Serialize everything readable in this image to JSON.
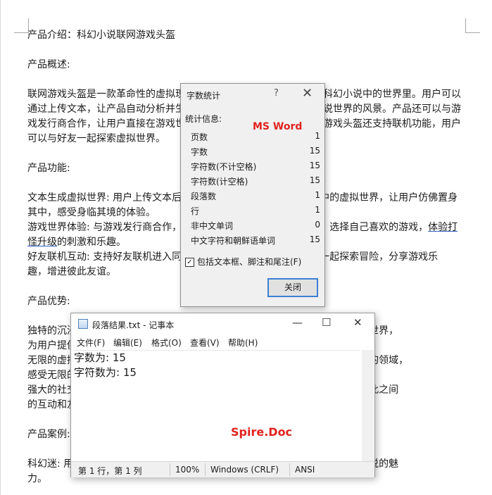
{
  "document": {
    "lines": [
      "产品介绍：科幻小说联网游戏头盔",
      "",
      "产品概述:",
      "",
      "联网游戏头盔是一款革命性的虚拟现实游戏设备，可以让用户沉浸在科幻小说中的世界里。用户可以",
      "通过上传文本，让产品自动分析并生成虚拟世界，让用户亲眼看到小说世界的风景。产品还可以与游",
      "戏发行商合作，让用户直接在游戏世界中体验小说的故事情节。联网游戏头盔还支持联机功能，用户",
      "可以与好友一起探索虚拟世界。",
      "",
      "产品功能:",
      "",
      "文本生成虚拟世界: 用户上传文本后，产品自动分析并生成对应小说中的虚拟世界，让用户仿佛置身",
      "其中，感受身临其境的体验。",
      "游戏世界体验: 与游戏发行商合作，用户可以在游戏世界中体验小说，选择自己喜欢的游戏，",
      "怪升级的刺激和乐趣。",
      "好友联机互动: 支持好友联机进入同一个虚拟世界，用户可以与好友一起探索冒险，分享游戏乐",
      "趣，增进彼此友谊。",
      "",
      "产品优势:",
      "",
      "独特的沉浸式体验: 利用先进的虚拟现实技术，产品可以根据小说文本生成虚拟世界，",
      "为用户提供身临其境的沉浸式体验。",
      "无限的虚拟世界: 用户可以上传任何小说文本，进入无数个虚拟世界，探索未知的领域，",
      "感受无限的可能。",
      "强大的社交功能: 支持好友联机，与好友一起探索冒险，分享游戏乐趣，增进彼此之间",
      "的互动和友谊。",
      "",
      "产品案例:",
      "",
      "科幻迷: 用户上传自己喜爱的科幻小说，进入虚拟世界中探险，亲身感受科幻小说的魅",
      "力。"
    ],
    "underlined_fragment": "体验打"
  },
  "word_count_dialog": {
    "title": "字数统计",
    "help": "?",
    "close": "✕",
    "section_label": "统计信息:",
    "brand_label": "MS Word",
    "rows": [
      {
        "label": "页数",
        "value": "1"
      },
      {
        "label": "字数",
        "value": "15"
      },
      {
        "label": "字符数(不计空格)",
        "value": "15"
      },
      {
        "label": "字符数(计空格)",
        "value": "15"
      },
      {
        "label": "段落数",
        "value": "1"
      },
      {
        "label": "行",
        "value": "1"
      },
      {
        "label": "非中文单词",
        "value": "0"
      },
      {
        "label": "中文字符和朝鲜语单词",
        "value": "15"
      }
    ],
    "checkbox_label": "包括文本框、脚注和尾注(F)",
    "checkbox_checked": "✓",
    "close_button": "关闭"
  },
  "notepad": {
    "title": "段落结果.txt - 记事本",
    "minimize": "—",
    "maximize": "☐",
    "close": "✕",
    "menu": [
      "文件(F)",
      "编辑(E)",
      "格式(O)",
      "查看(V)",
      "帮助(H)"
    ],
    "content": [
      "字数为: 15",
      "字符数为: 15"
    ],
    "brand_label": "Spire.Doc",
    "status": {
      "position": "第 1 行，第 1 列",
      "zoom": "100%",
      "line_ending": "Windows (CRLF)",
      "encoding": "ANSI"
    }
  }
}
